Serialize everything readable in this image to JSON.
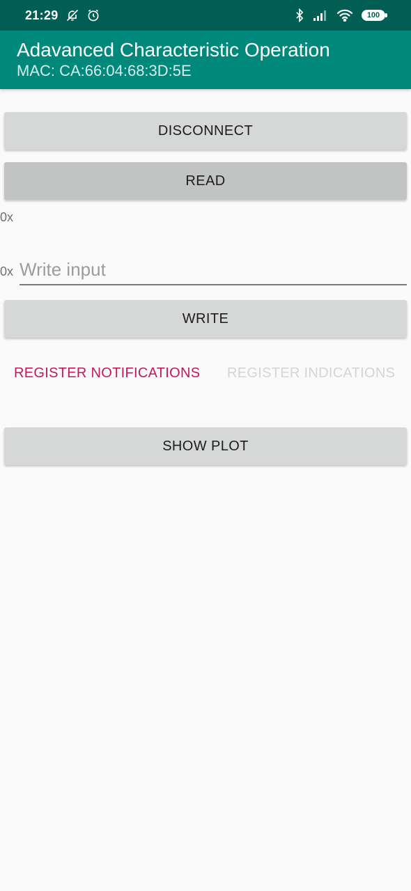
{
  "status_bar": {
    "time": "21:29",
    "icons": [
      "bell-off-icon",
      "alarm-icon",
      "bluetooth-icon",
      "signal-icon",
      "wifi-icon"
    ],
    "battery": "100"
  },
  "app_bar": {
    "title": "Adavanced Characteristic Operation",
    "subtitle": "MAC: CA:66:04:68:3D:5E"
  },
  "buttons": {
    "disconnect": "DISCONNECT",
    "read": "READ",
    "write": "WRITE",
    "show_plot": "SHOW PLOT"
  },
  "read_value": {
    "prefix": "0x"
  },
  "write_field": {
    "prefix": "0x",
    "placeholder": "Write input"
  },
  "register": {
    "notifications": "REGISTER NOTIFICATIONS",
    "indications": "REGISTER INDICATIONS"
  },
  "colors": {
    "status_bar": "#005e52",
    "app_bar": "#00897b",
    "accent": "#c2185b",
    "disabled_text": "#d4d4d4"
  }
}
